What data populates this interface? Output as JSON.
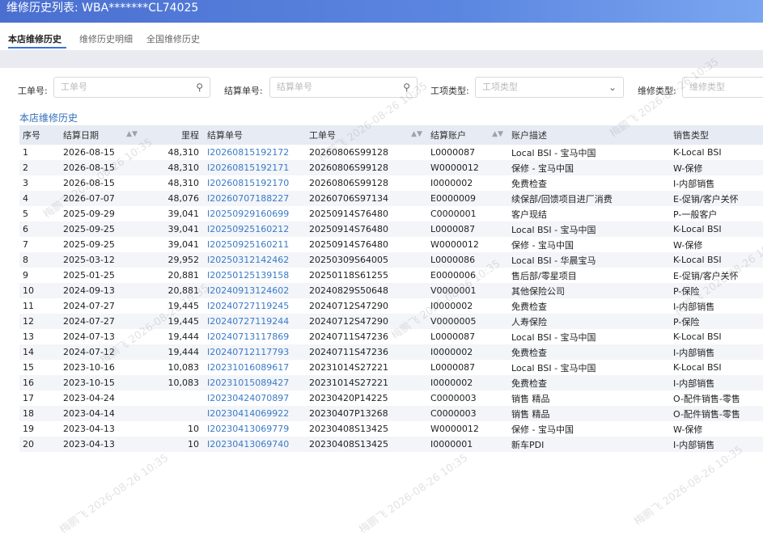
{
  "window": {
    "title": "维修历史列表: WBA*******CL74025"
  },
  "tabs": [
    {
      "label": "本店维修历史"
    },
    {
      "label": "维修历史明细"
    },
    {
      "label": "全国维修历史"
    }
  ],
  "filters": {
    "work_order": {
      "label": "工单号:",
      "placeholder": "工单号"
    },
    "settlement": {
      "label": "结算单号:",
      "placeholder": "结算单号"
    },
    "item_type": {
      "label": "工项类型:",
      "placeholder": "工项类型"
    },
    "repair_type": {
      "label": "维修类型:",
      "placeholder": "维修类型"
    }
  },
  "section": {
    "title": "本店维修历史"
  },
  "table": {
    "columns": [
      "序号",
      "结算日期",
      "里程",
      "结算单号",
      "工单号",
      "结算账户",
      "账户描述",
      "销售类型"
    ],
    "rows": [
      [
        "1",
        "2026-08-15",
        "48,310",
        "I20260815192172",
        "20260806S99128",
        "L0000087",
        "Local BSI - 宝马中国",
        "K-Local BSI"
      ],
      [
        "2",
        "2026-08-15",
        "48,310",
        "I20260815192171",
        "20260806S99128",
        "W0000012",
        "保修 - 宝马中国",
        "W-保修"
      ],
      [
        "3",
        "2026-08-15",
        "48,310",
        "I20260815192170",
        "20260806S99128",
        "I0000002",
        "免费检查",
        "I-内部销售"
      ],
      [
        "4",
        "2026-07-07",
        "48,076",
        "I20260707188227",
        "20260706S97134",
        "E0000009",
        "续保部/回馈项目进厂消费",
        "E-促销/客户关怀"
      ],
      [
        "5",
        "2025-09-29",
        "39,041",
        "I20250929160699",
        "20250914S76480",
        "C0000001",
        "客户现结",
        "P-一般客户"
      ],
      [
        "6",
        "2025-09-25",
        "39,041",
        "I20250925160212",
        "20250914S76480",
        "L0000087",
        "Local BSI - 宝马中国",
        "K-Local BSI"
      ],
      [
        "7",
        "2025-09-25",
        "39,041",
        "I20250925160211",
        "20250914S76480",
        "W0000012",
        "保修 - 宝马中国",
        "W-保修"
      ],
      [
        "8",
        "2025-03-12",
        "29,952",
        "I20250312142462",
        "20250309S64005",
        "L0000086",
        "Local BSI - 华晨宝马",
        "K-Local BSI"
      ],
      [
        "9",
        "2025-01-25",
        "20,881",
        "I20250125139158",
        "20250118S61255",
        "E0000006",
        "售后部/零星项目",
        "E-促销/客户关怀"
      ],
      [
        "10",
        "2024-09-13",
        "20,881",
        "I20240913124602",
        "20240829S50648",
        "V0000001",
        "其他保险公司",
        "P-保险"
      ],
      [
        "11",
        "2024-07-27",
        "19,445",
        "I20240727119245",
        "20240712S47290",
        "I0000002",
        "免费检查",
        "I-内部销售"
      ],
      [
        "12",
        "2024-07-27",
        "19,445",
        "I20240727119244",
        "20240712S47290",
        "V0000005",
        "人寿保险",
        "P-保险"
      ],
      [
        "13",
        "2024-07-13",
        "19,444",
        "I20240713117869",
        "20240711S47236",
        "L0000087",
        "Local BSI - 宝马中国",
        "K-Local BSI"
      ],
      [
        "14",
        "2024-07-12",
        "19,444",
        "I20240712117793",
        "20240711S47236",
        "I0000002",
        "免费检查",
        "I-内部销售"
      ],
      [
        "15",
        "2023-10-16",
        "10,083",
        "I20231016089617",
        "20231014S27221",
        "L0000087",
        "Local BSI - 宝马中国",
        "K-Local BSI"
      ],
      [
        "16",
        "2023-10-15",
        "10,083",
        "I20231015089427",
        "20231014S27221",
        "I0000002",
        "免费检查",
        "I-内部销售"
      ],
      [
        "17",
        "2023-04-24",
        "",
        "I20230424070897",
        "20230420P14225",
        "C0000003",
        "销售 精品",
        "O-配件销售-零售"
      ],
      [
        "18",
        "2023-04-14",
        "",
        "I20230414069922",
        "20230407P13268",
        "C0000003",
        "销售 精品",
        "O-配件销售-零售"
      ],
      [
        "19",
        "2023-04-13",
        "10",
        "I20230413069779",
        "20230408S13425",
        "W0000012",
        "保修 - 宝马中国",
        "W-保修"
      ],
      [
        "20",
        "2023-04-13",
        "10",
        "I20230413069740",
        "20230408S13425",
        "I0000001",
        "新车PDI",
        "I-内部销售"
      ]
    ]
  },
  "watermark": {
    "text": "梅鹏飞 2026-08-26 10:35"
  },
  "icons": {
    "search": "search-icon",
    "dropdown": "chevron-down-icon",
    "sort": "sort-icon"
  },
  "colors": {
    "titlebar": "#4a6fd0",
    "link": "#3a7ac8",
    "header_bg": "#e6ebf4"
  }
}
